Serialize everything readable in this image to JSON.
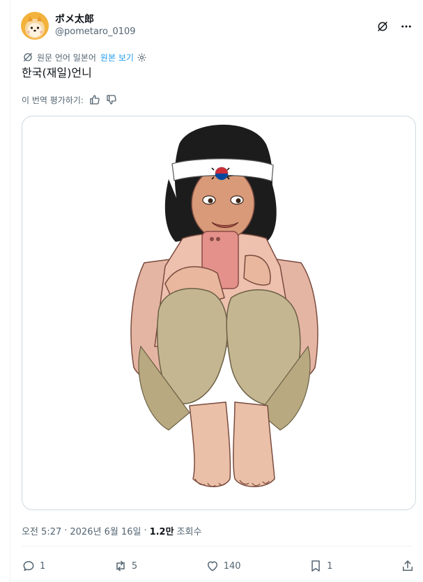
{
  "author": {
    "display_name": "ポメ太郎",
    "handle": "@pometaro_0109",
    "avatar_icon": "pomeranian-avatar"
  },
  "header_actions": {
    "grok_icon": "grok-icon",
    "more_icon": "more-dots-icon"
  },
  "translation": {
    "notice": "원문 언어 일본어",
    "show_original": "원본 보기"
  },
  "tweet": {
    "text": "한국(재일)언니"
  },
  "rating": {
    "prompt": "이 번역 평가하기:"
  },
  "media": {
    "description_icon": "illustration-woman-with-phone",
    "headband_flag": "korean-flag"
  },
  "meta": {
    "time": "오전 5:27",
    "separator": "·",
    "date": "2026년 6월 16일",
    "views_count": "1.2만",
    "views_label": "조회수"
  },
  "actions": {
    "replies": "1",
    "reposts": "5",
    "likes": "140",
    "bookmarks": "1"
  },
  "colors": {
    "accent": "#1d9bf0",
    "text_primary": "#0f1419",
    "text_secondary": "#536471",
    "border": "#cfd9de"
  }
}
